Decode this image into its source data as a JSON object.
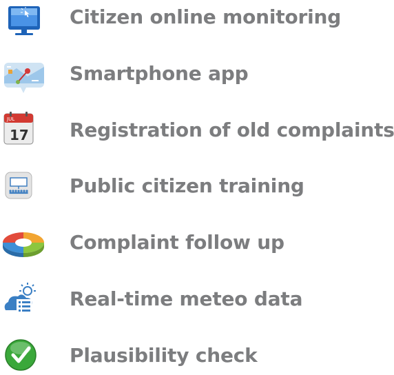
{
  "items": [
    {
      "label": "Citizen online monitoring",
      "icon": "computer-monitor-icon"
    },
    {
      "label": "Smartphone app",
      "icon": "map-pin-app-icon"
    },
    {
      "label": "Registration of old complaints",
      "icon": "calendar-icon",
      "icon_text": "17",
      "icon_month": "JUL"
    },
    {
      "label": "Public citizen training",
      "icon": "presentation-board-icon"
    },
    {
      "label": "Complaint follow up",
      "icon": "cycle-diagram-icon"
    },
    {
      "label": "Real-time meteo data",
      "icon": "weather-cloud-icon"
    },
    {
      "label": "Plausibility check",
      "icon": "checkmark-icon"
    }
  ],
  "colors": {
    "label": "#7c7d7f",
    "check": "#3aa83a",
    "monitor": "#1e63b8"
  }
}
